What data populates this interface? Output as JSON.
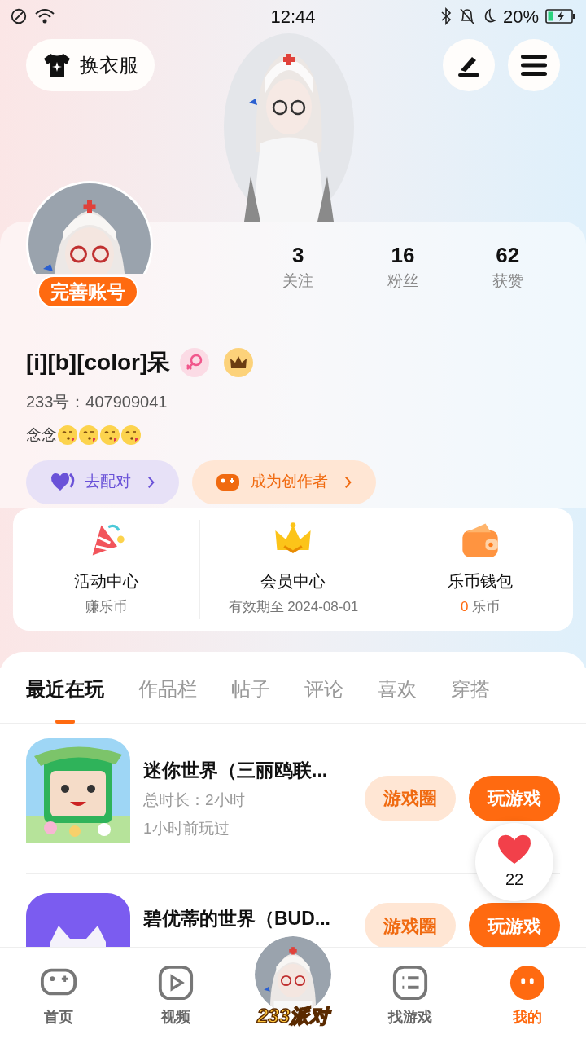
{
  "status_bar": {
    "time": "12:44",
    "battery": "20%"
  },
  "outfit_button": {
    "label": "换衣服"
  },
  "profile": {
    "badge": "完善账号",
    "name": "[i][b][color]呆",
    "id": "233号：407909041",
    "bio": "念念"
  },
  "stats": [
    {
      "value": "3",
      "label": "关注"
    },
    {
      "value": "16",
      "label": "粉丝"
    },
    {
      "value": "62",
      "label": "获赞"
    }
  ],
  "actions": [
    {
      "label": "去配对",
      "kind": "match"
    },
    {
      "label": "成为创作者",
      "kind": "creator"
    }
  ],
  "services": [
    {
      "kind": "events",
      "title": "活动中心",
      "subtitle": "赚乐币"
    },
    {
      "kind": "vip",
      "title": "会员中心",
      "subtitle": "有效期至 2024-08-01"
    },
    {
      "kind": "wallet",
      "title": "乐币钱包",
      "value": "0",
      "subtitle": "乐币"
    }
  ],
  "tabs": [
    {
      "label": "最近在玩",
      "selected": true
    },
    {
      "label": "作品栏",
      "selected": false
    },
    {
      "label": "帖子",
      "selected": false
    },
    {
      "label": "评论",
      "selected": false
    },
    {
      "label": "喜欢",
      "selected": false
    },
    {
      "label": "穿搭",
      "selected": false
    }
  ],
  "games": [
    {
      "title": "迷你世界（三丽鸥联...",
      "duration": "总时长：2小时",
      "last_played": "1小时前玩过",
      "circle_button": "游戏圈",
      "play_button": "玩游戏",
      "kind": "green"
    },
    {
      "title": "碧优蒂的世界（BUD...",
      "circle_button": "游戏圈",
      "play_button": "玩游戏",
      "kind": "purple"
    }
  ],
  "like_bubble": {
    "count": "22"
  },
  "nav": [
    {
      "kind": "home",
      "label": "首页",
      "selected": false
    },
    {
      "kind": "video",
      "label": "视频",
      "selected": false
    },
    {
      "kind": "party",
      "label": "233派对",
      "selected": false
    },
    {
      "kind": "find",
      "label": "找游戏",
      "selected": false
    },
    {
      "kind": "mine",
      "label": "我的",
      "selected": true
    }
  ]
}
